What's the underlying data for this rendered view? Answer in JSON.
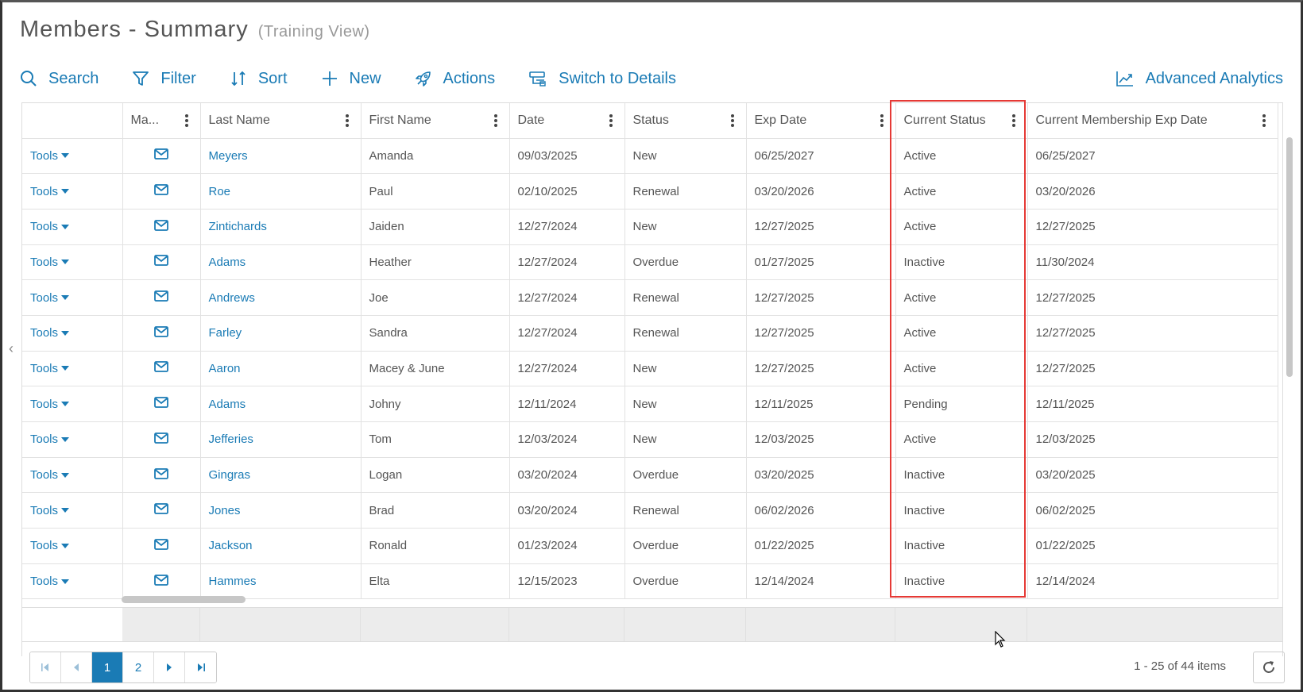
{
  "page": {
    "title": "Members - Summary",
    "subtitle": "(Training View)"
  },
  "toolbar": {
    "search": "Search",
    "filter": "Filter",
    "sort": "Sort",
    "new": "New",
    "actions": "Actions",
    "switch": "Switch to Details",
    "analytics": "Advanced Analytics"
  },
  "grid": {
    "columns": [
      "",
      "Ma...",
      "Last Name",
      "First Name",
      "Date",
      "Status",
      "Exp Date",
      "Current Status",
      "Current Membership Exp Date"
    ],
    "tools_label": "Tools",
    "rows": [
      {
        "last": "Meyers",
        "first": "Amanda",
        "date": "09/03/2025",
        "status": "New",
        "exp": "06/25/2027",
        "current": "Active",
        "cur_exp": "06/25/2027"
      },
      {
        "last": "Roe",
        "first": "Paul",
        "date": "02/10/2025",
        "status": "Renewal",
        "exp": "03/20/2026",
        "current": "Active",
        "cur_exp": "03/20/2026"
      },
      {
        "last": "Zintichards",
        "first": "Jaiden",
        "date": "12/27/2024",
        "status": "New",
        "exp": "12/27/2025",
        "current": "Active",
        "cur_exp": "12/27/2025"
      },
      {
        "last": "Adams",
        "first": "Heather",
        "date": "12/27/2024",
        "status": "Overdue",
        "exp": "01/27/2025",
        "current": "Inactive",
        "cur_exp": "11/30/2024"
      },
      {
        "last": "Andrews",
        "first": "Joe",
        "date": "12/27/2024",
        "status": "Renewal",
        "exp": "12/27/2025",
        "current": "Active",
        "cur_exp": "12/27/2025"
      },
      {
        "last": "Farley",
        "first": "Sandra",
        "date": "12/27/2024",
        "status": "Renewal",
        "exp": "12/27/2025",
        "current": "Active",
        "cur_exp": "12/27/2025"
      },
      {
        "last": "Aaron",
        "first": "Macey & June",
        "date": "12/27/2024",
        "status": "New",
        "exp": "12/27/2025",
        "current": "Active",
        "cur_exp": "12/27/2025"
      },
      {
        "last": "Adams",
        "first": "Johny",
        "date": "12/11/2024",
        "status": "New",
        "exp": "12/11/2025",
        "current": "Pending",
        "cur_exp": "12/11/2025"
      },
      {
        "last": "Jefferies",
        "first": "Tom",
        "date": "12/03/2024",
        "status": "New",
        "exp": "12/03/2025",
        "current": "Active",
        "cur_exp": "12/03/2025"
      },
      {
        "last": "Gingras",
        "first": "Logan",
        "date": "03/20/2024",
        "status": "Overdue",
        "exp": "03/20/2025",
        "current": "Inactive",
        "cur_exp": "03/20/2025"
      },
      {
        "last": "Jones",
        "first": "Brad",
        "date": "03/20/2024",
        "status": "Renewal",
        "exp": "06/02/2026",
        "current": "Inactive",
        "cur_exp": "06/02/2025"
      },
      {
        "last": "Jackson",
        "first": "Ronald",
        "date": "01/23/2024",
        "status": "Overdue",
        "exp": "01/22/2025",
        "current": "Inactive",
        "cur_exp": "01/22/2025"
      },
      {
        "last": "Hammes",
        "first": "Elta",
        "date": "12/15/2023",
        "status": "Overdue",
        "exp": "12/14/2024",
        "current": "Inactive",
        "cur_exp": "12/14/2024"
      }
    ]
  },
  "pager": {
    "pages": [
      "1",
      "2"
    ],
    "active": "1",
    "summary": "1 - 25 of 44 items"
  },
  "colors": {
    "accent": "#1a7bb5",
    "highlight": "#e53935"
  }
}
